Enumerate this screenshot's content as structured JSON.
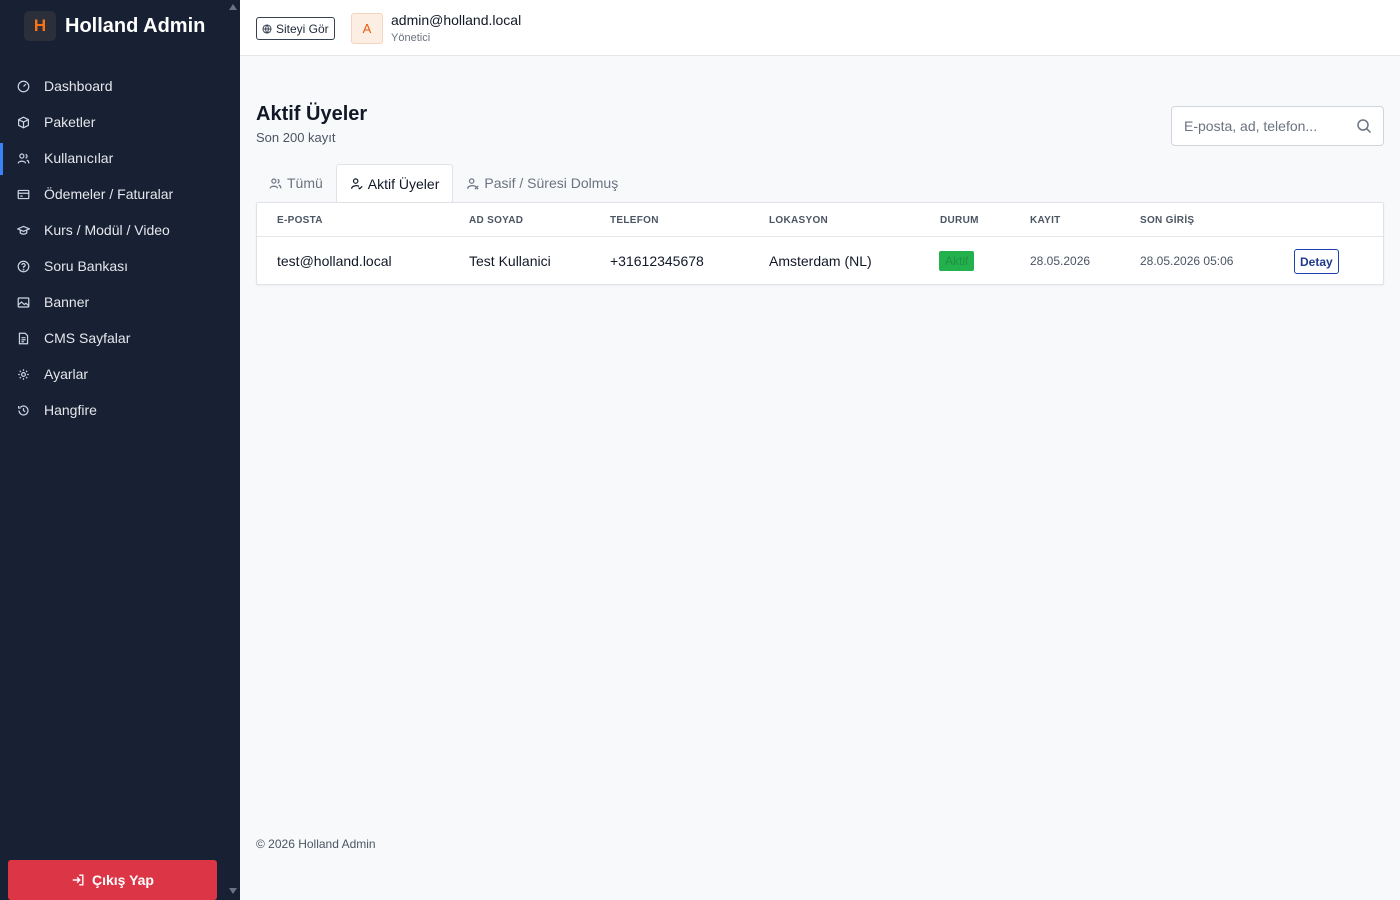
{
  "brand": {
    "mark": "H",
    "name": "Holland Admin"
  },
  "sidebar": {
    "items": [
      {
        "label": "Dashboard",
        "icon": "gauge-icon"
      },
      {
        "label": "Paketler",
        "icon": "box-icon"
      },
      {
        "label": "Kullanıcılar",
        "icon": "users-icon",
        "active": true
      },
      {
        "label": "Ödemeler / Faturalar",
        "icon": "card-icon"
      },
      {
        "label": "Kurs / Modül / Video",
        "icon": "graduation-cap-icon"
      },
      {
        "label": "Soru Bankası",
        "icon": "question-icon"
      },
      {
        "label": "Banner",
        "icon": "image-icon"
      },
      {
        "label": "CMS Sayfalar",
        "icon": "document-icon"
      },
      {
        "label": "Ayarlar",
        "icon": "gear-icon"
      },
      {
        "label": "Hangfire",
        "icon": "history-icon"
      }
    ],
    "logout_label": "Çıkış Yap"
  },
  "topbar": {
    "site_button": "Siteyi Gör",
    "avatar_initial": "A",
    "user_email": "admin@holland.local",
    "user_role": "Yönetici"
  },
  "main": {
    "title": "Aktif Üyeler",
    "subtitle": "Son 200 kayıt",
    "search_placeholder": "E-posta, ad, telefon...",
    "tabs": [
      {
        "label": "Tümü",
        "icon": "users-icon"
      },
      {
        "label": "Aktif Üyeler",
        "icon": "user-check-icon",
        "active": true
      },
      {
        "label": "Pasif / Süresi Dolmuş",
        "icon": "user-x-icon"
      }
    ],
    "table": {
      "headers": [
        "E-POSTA",
        "AD SOYAD",
        "TELEFON",
        "LOKASYON",
        "DURUM",
        "KAYIT",
        "SON GİRİŞ"
      ],
      "rows": [
        {
          "email": "test@holland.local",
          "name": "Test Kullanici",
          "phone": "+31612345678",
          "location": "Amsterdam (NL)",
          "status": "Aktif",
          "registered": "28.05.2026",
          "last_login": "28.05.2026 05:06",
          "action": "Detay"
        }
      ]
    }
  },
  "footer": {
    "text": "© 2026 Holland Admin"
  },
  "colors": {
    "sidebar_bg": "#172133",
    "accent": "#f97316",
    "active_indicator": "#3b82f6",
    "danger": "#dc3545",
    "success": "#22b14c"
  }
}
